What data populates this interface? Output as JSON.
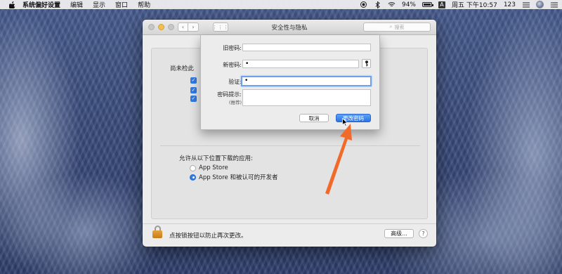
{
  "menubar": {
    "app_name": "系统偏好设置",
    "items": [
      "编辑",
      "显示",
      "窗口",
      "帮助"
    ],
    "battery": "94%",
    "input_source": "A",
    "clock": "周五 下午10:57",
    "extra": "123"
  },
  "window": {
    "title": "安全性与隐私",
    "search_placeholder": "搜索",
    "not_checked_text": "尚未检此",
    "allow_label": "允许从以下位置下载的应用:",
    "radio_options": [
      {
        "label": "App Store",
        "selected": false
      },
      {
        "label": "App Store 和被认可的开发者",
        "selected": true
      }
    ],
    "lock_text": "点按锁按钮以防止再次更改。",
    "advanced_label": "高级...",
    "help_label": "?"
  },
  "sheet": {
    "old_password_label": "旧密码:",
    "old_password_value": "",
    "new_password_label": "新密码:",
    "new_password_value": "•",
    "verify_label": "验证:",
    "verify_value": "•",
    "hint_label": "密码提示:",
    "hint_sub": "(推荐)",
    "hint_value": "",
    "cancel_label": "取消",
    "change_label": "更改密码"
  },
  "colors": {
    "accent": "#2f7ae5",
    "annotation_arrow": "#f26a2a",
    "lock": "#e09a35"
  }
}
